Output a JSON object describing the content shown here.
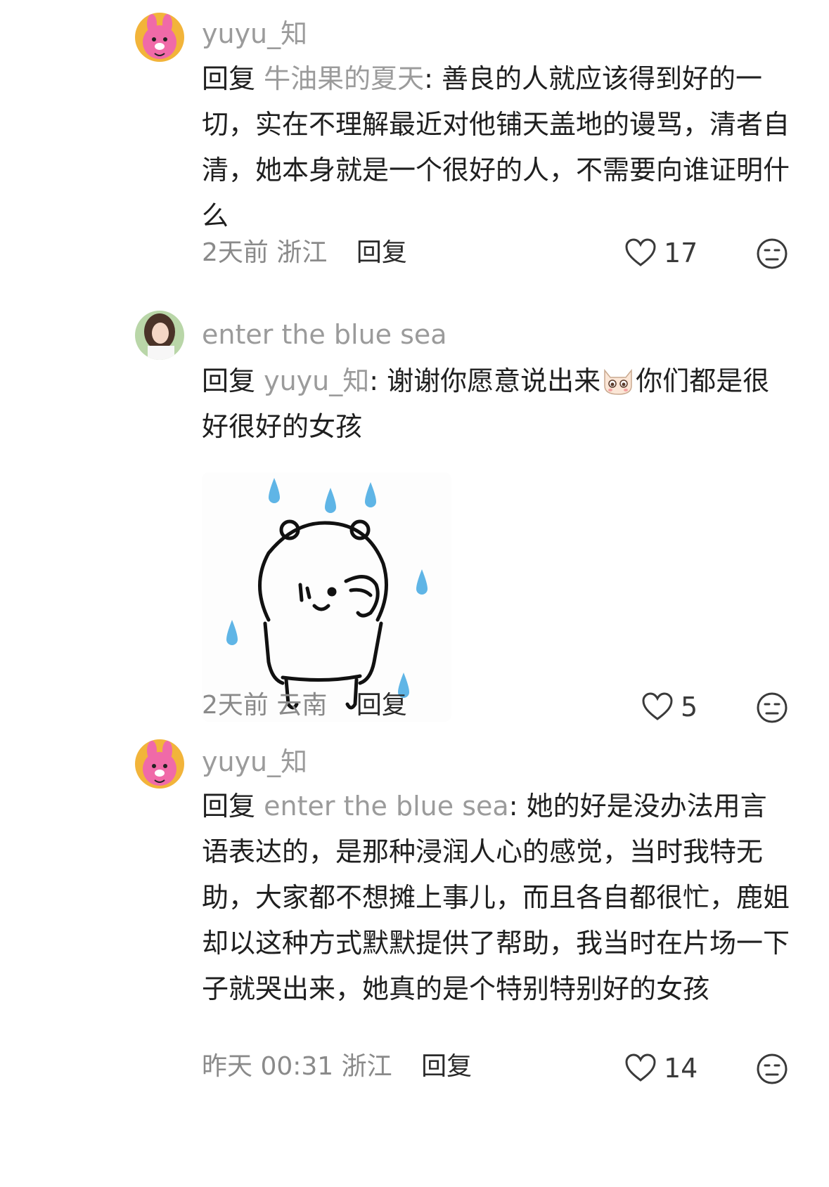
{
  "comments": [
    {
      "username": "yuyu_知",
      "reply_prefix": "回复",
      "mention": "牛油果的夏天",
      "separator": ":",
      "text": "善良的人就应该得到好的一切，实在不理解最近对他铺天盖地的谩骂，清者自清，她本身就是一个很好的人，不需要向谁证明什么",
      "time": "2天前",
      "location": "浙江",
      "reply_label": "回复",
      "likes": "17",
      "avatar_icon": "pink-bunny-avatar-icon"
    },
    {
      "username": "enter the blue sea",
      "reply_prefix": "回复",
      "mention": "yuyu_知",
      "separator": ":",
      "text_before_emoji": "谢谢你愿意说出来",
      "text_after_emoji": "你们都是很好很好的女孩",
      "time": "2天前",
      "location": "云南",
      "reply_label": "回复",
      "likes": "5",
      "avatar_icon": "girl-photo-avatar-icon",
      "sticker_icon": "sweating-bear-sticker-icon",
      "emoji_icon": "crying-cat-emoji-icon"
    },
    {
      "username": "yuyu_知",
      "reply_prefix": "回复",
      "mention": "enter the blue sea",
      "separator": ":",
      "text": "她的好是没办法用言语表达的，是那种浸润人心的感觉，当时我特无助，大家都不想摊上事儿，而且各自都很忙，鹿姐却以这种方式默默提供了帮助，我当时在片场一下子就哭出来，她真的是个特别特别好的女孩",
      "time": "昨天 00:31",
      "location": "浙江",
      "reply_label": "回复",
      "likes": "14",
      "avatar_icon": "pink-bunny-avatar-icon"
    }
  ],
  "colors": {
    "text": "#1f1f1f",
    "muted": "#9b9b9b",
    "drop_blue": "#5fb5e6"
  }
}
